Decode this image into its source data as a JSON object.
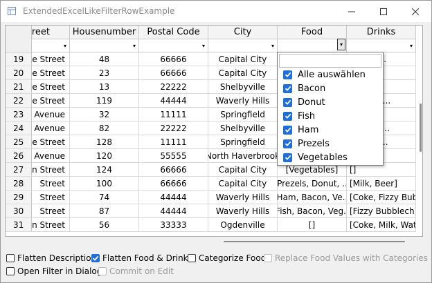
{
  "window": {
    "title": "ExtendedExcelLikeFilterRowExample"
  },
  "columns": [
    "reet",
    "Housenumber",
    "Postal Code",
    "City",
    "Food",
    "Drinks"
  ],
  "rows": [
    {
      "num": "19",
      "street": "ove Street",
      "house": "48",
      "postal": "66666",
      "city": "Capital City",
      "food": "",
      "drinks": "ter, Mil..."
    },
    {
      "num": "20",
      "street": "ove Street",
      "house": "23",
      "postal": "66666",
      "city": "Capital City",
      "food": "",
      "drinks": "ke]"
    },
    {
      "num": "21",
      "street": "ove Street",
      "house": "13",
      "postal": "22222",
      "city": "Shelbyville",
      "food": "",
      "drinks": "er]"
    },
    {
      "num": "22",
      "street": "ove Street",
      "house": "119",
      "postal": "44444",
      "city": "Waverly Hills",
      "food": "",
      "drinks": "bblech, ..."
    },
    {
      "num": "23",
      "street": "d Avenue",
      "house": "32",
      "postal": "11111",
      "city": "Springfield",
      "food": "",
      "drinks": "Milk]"
    },
    {
      "num": "24",
      "street": "d Avenue",
      "house": "82",
      "postal": "22222",
      "city": "Shelbyville",
      "food": "",
      "drinks": "ter, Fizz..."
    },
    {
      "num": "25",
      "street": "ove Street",
      "house": "128",
      "postal": "11111",
      "city": "Springfield",
      "food": "",
      "drinks": "ke, Sod..."
    },
    {
      "num": "26",
      "street": "d Avenue",
      "house": "120",
      "postal": "55555",
      "city": "North Haverbrook",
      "food": "",
      "drinks": ""
    },
    {
      "num": "27",
      "street": "n Street",
      "house": "124",
      "postal": "66666",
      "city": "Capital City",
      "food": "[Vegetables]",
      "drinks": "[]"
    },
    {
      "num": "28",
      "street": "Street",
      "house": "100",
      "postal": "66666",
      "city": "Capital City",
      "food": "[Prezels, Donut, ...",
      "drinks": "[Milk, Beer]"
    },
    {
      "num": "29",
      "street": "Street",
      "house": "74",
      "postal": "44444",
      "city": "Waverly Hills",
      "food": "[Ham, Bacon, Ve...",
      "drinks": "[Coke, Fizzy Bub..."
    },
    {
      "num": "30",
      "street": "Street",
      "house": "87",
      "postal": "44444",
      "city": "Waverly Hills",
      "food": "[Fish, Bacon, Veg...",
      "drinks": "[Fizzy Bubblech]"
    },
    {
      "num": "31",
      "street": "n Street",
      "house": "56",
      "postal": "33333",
      "city": "Ogdenville",
      "food": "[]",
      "drinks": "[Coke, Milk, Wat..."
    }
  ],
  "popup": {
    "items": [
      "Alle auswählen",
      "Bacon",
      "Donut",
      "Fish",
      "Ham",
      "Prezels",
      "Vegetables"
    ]
  },
  "options": [
    {
      "label": "Flatten Description",
      "checked": false,
      "enabled": true
    },
    {
      "label": "Flatten Food & Drinks",
      "checked": true,
      "enabled": true
    },
    {
      "label": "Categorize Food",
      "checked": false,
      "enabled": true
    },
    {
      "label": "Replace Food Values with Categories",
      "checked": false,
      "enabled": false
    },
    {
      "label": "Open Filter in Dialog",
      "checked": false,
      "enabled": true
    },
    {
      "label": "Commit on Edit",
      "checked": false,
      "enabled": false
    }
  ],
  "colors": {
    "accent": "#1f6fd6",
    "border": "#aaaaaa",
    "header_bg": "#f4f4f4"
  }
}
